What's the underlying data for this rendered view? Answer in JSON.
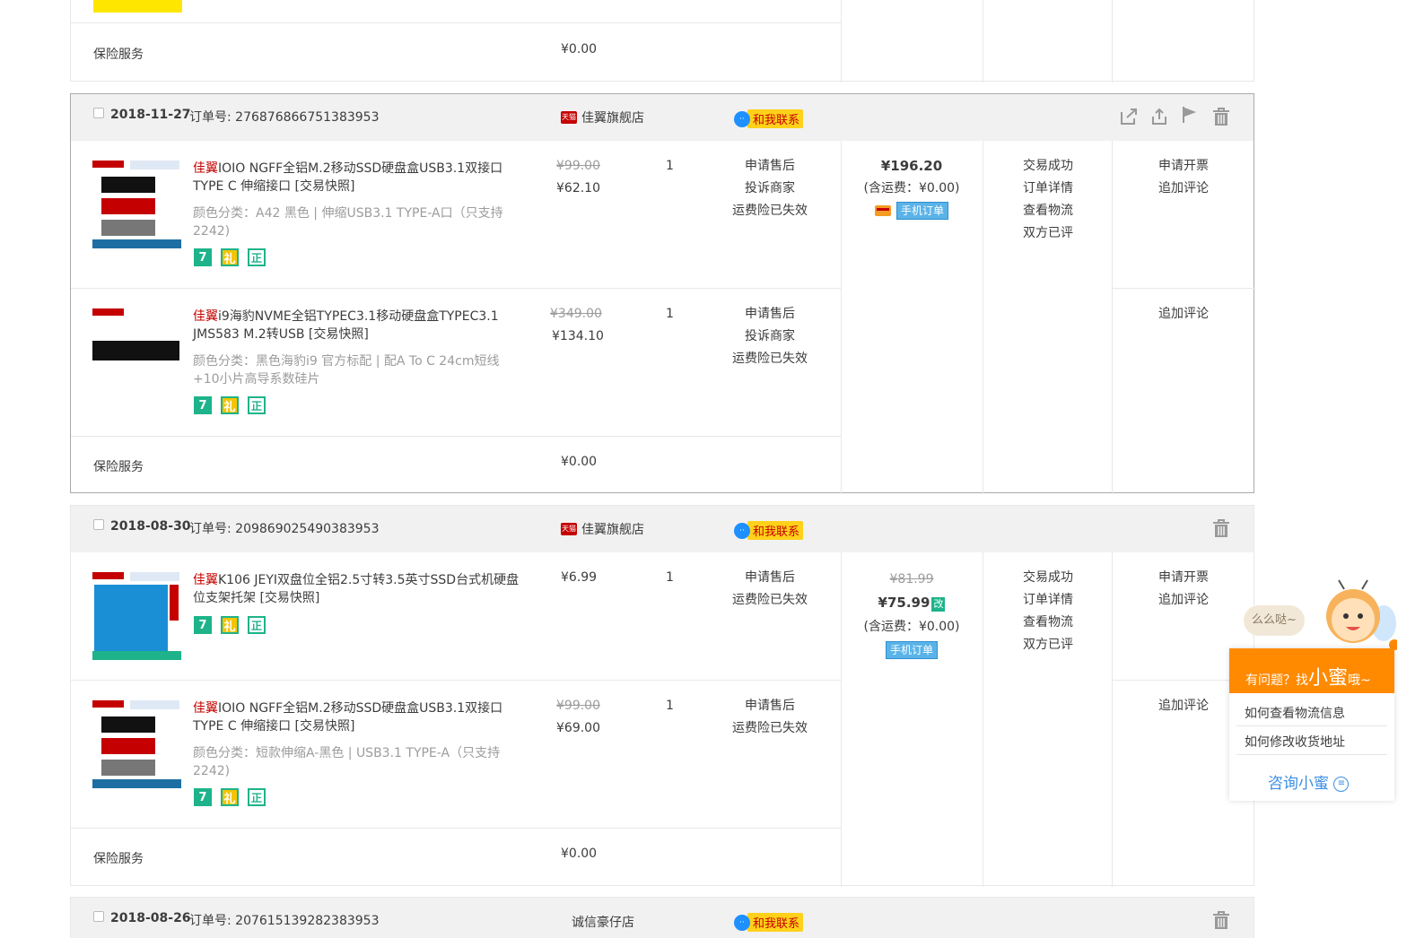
{
  "top_fragment": {
    "insurance_label": "保险服务",
    "insurance_price": "¥0.00"
  },
  "orders": [
    {
      "date": "2018-11-27",
      "order_no": "订单号: 276876866751383953",
      "shop_badge": "天猫",
      "shop": "佳翼旗舰店",
      "contact": "和我联系",
      "total": "¥196.20",
      "total_old": "",
      "shipping": "(含运费：¥0.00)",
      "mobile_tag": "手机订单",
      "status": [
        "交易成功",
        "订单详情",
        "查看物流",
        "双方已评"
      ],
      "items": [
        {
          "brand": "佳翼",
          "name": "IOIO NGFF全铝M.2移动SSD硬盘盒USB3.1双接口TYPE C 伸缩接口 [交易快照]",
          "sku": "颜色分类：A42 黑色 | 伸缩USB3.1 TYPE-A口（只支持2242)",
          "price_old": "¥99.00",
          "price": "¥62.10",
          "qty": "1",
          "links": [
            "申请售后",
            "投诉商家",
            "运费险已失效"
          ],
          "actions": [
            "申请开票",
            "追加评论"
          ]
        },
        {
          "brand": "佳翼",
          "name": "i9海豹NVME全铝TYPEC3.1移动硬盘盒TYPEC3.1 JMS583 M.2转USB [交易快照]",
          "sku": "颜色分类：黑色海豹i9 官方标配 | 配A To C 24cm短线+10小片高导系数硅片",
          "price_old": "¥349.00",
          "price": "¥134.10",
          "qty": "1",
          "links": [
            "申请售后",
            "投诉商家",
            "运费险已失效"
          ],
          "actions": [
            "追加评论"
          ]
        }
      ],
      "insurance_label": "保险服务",
      "insurance_price": "¥0.00"
    },
    {
      "date": "2018-08-30",
      "order_no": "订单号: 209869025490383953",
      "shop_badge": "天猫",
      "shop": "佳翼旗舰店",
      "contact": "和我联系",
      "total": "¥75.99",
      "total_old": "¥81.99",
      "modified_tag": "改",
      "shipping": "(含运费：¥0.00)",
      "mobile_tag": "手机订单",
      "status": [
        "交易成功",
        "订单详情",
        "查看物流",
        "双方已评"
      ],
      "items": [
        {
          "brand": "佳翼",
          "name": "K106 JEYI双盘位全铝2.5寸转3.5英寸SSD台式机硬盘位支架托架 [交易快照]",
          "sku": "",
          "price_old": "",
          "price": "¥6.99",
          "qty": "1",
          "links": [
            "申请售后",
            "运费险已失效"
          ],
          "actions": [
            "申请开票",
            "追加评论"
          ]
        },
        {
          "brand": "佳翼",
          "name": "IOIO NGFF全铝M.2移动SSD硬盘盒USB3.1双接口TYPE C 伸缩接口 [交易快照]",
          "sku": "颜色分类：短款伸缩A-黑色 | USB3.1 TYPE-A（只支持2242)",
          "price_old": "¥99.00",
          "price": "¥69.00",
          "qty": "1",
          "links": [
            "申请售后",
            "运费险已失效"
          ],
          "actions": [
            "追加评论"
          ]
        }
      ],
      "insurance_label": "保险服务",
      "insurance_price": "¥0.00"
    },
    {
      "date": "2018-08-26",
      "order_no": "订单号: 207615139282383953",
      "shop": "诚信豪仔店",
      "contact": "和我联系"
    }
  ],
  "badges": [
    "7",
    "礼",
    "正"
  ],
  "helper": {
    "bubble": "么么哒~",
    "banner_prefix": "有问题？找",
    "banner_name": "小蜜",
    "banner_suffix": "哦~",
    "questions": [
      "如何查看物流信息",
      "如何修改收货地址"
    ],
    "consult": "咨询小蜜"
  },
  "colors": {
    "brand_red": "#c40000",
    "badge_green": "#1eb38a",
    "helper_orange": "#ff8a00",
    "link_blue": "#3a8ee6"
  }
}
